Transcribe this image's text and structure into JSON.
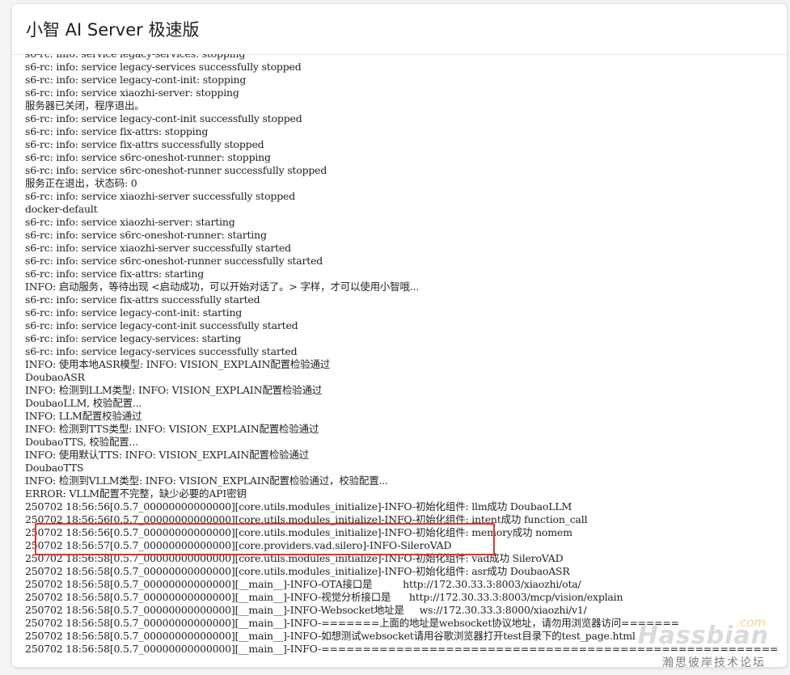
{
  "app": {
    "title": "小智 AI Server 极速版"
  },
  "log": {
    "lines": [
      "s6-rc: info: service legacy-services: stopping",
      "s6-rc: info: service legacy-services successfully stopped",
      "s6-rc: info: service legacy-cont-init: stopping",
      "s6-rc: info: service xiaozhi-server: stopping",
      "服务器已关闭，程序退出。",
      "s6-rc: info: service legacy-cont-init successfully stopped",
      "s6-rc: info: service fix-attrs: stopping",
      "s6-rc: info: service fix-attrs successfully stopped",
      "s6-rc: info: service s6rc-oneshot-runner: stopping",
      "s6-rc: info: service s6rc-oneshot-runner successfully stopped",
      "服务正在退出，状态码: 0",
      "s6-rc: info: service xiaozhi-server successfully stopped",
      "docker-default",
      "s6-rc: info: service xiaozhi-server: starting",
      "s6-rc: info: service s6rc-oneshot-runner: starting",
      "s6-rc: info: service xiaozhi-server successfully started",
      "s6-rc: info: service s6rc-oneshot-runner successfully started",
      "s6-rc: info: service fix-attrs: starting",
      "INFO: 启动服务，等待出现 <启动成功，可以开始对话了。> 字样，才可以使用小智哦...",
      "s6-rc: info: service fix-attrs successfully started",
      "s6-rc: info: service legacy-cont-init: starting",
      "s6-rc: info: service legacy-cont-init successfully started",
      "s6-rc: info: service legacy-services: starting",
      "s6-rc: info: service legacy-services successfully started",
      "INFO: 使用本地ASR模型: INFO: VISION_EXPLAIN配置检验通过",
      "DoubaoASR",
      "INFO: 检测到LLM类型: INFO: VISION_EXPLAIN配置检验通过",
      "DoubaoLLM, 校验配置...",
      "INFO: LLM配置校验通过",
      "INFO: 检测到TTS类型: INFO: VISION_EXPLAIN配置检验通过",
      "DoubaoTTS, 校验配置...",
      "INFO: 使用默认TTS: INFO: VISION_EXPLAIN配置检验通过",
      "DoubaoTTS",
      "INFO: 检测到VLLM类型: INFO: VISION_EXPLAIN配置检验通过，校验配置...",
      "ERROR: VLLM配置不完整，缺少必要的API密钥",
      "250702 18:56:56[0.5.7_00000000000000][core.utils.modules_initialize]-INFO-初始化组件: llm成功 DoubaoLLM",
      "250702 18:56:56[0.5.7_00000000000000][core.utils.modules_initialize]-INFO-初始化组件: intent成功 function_call",
      "250702 18:56:56[0.5.7_00000000000000][core.utils.modules_initialize]-INFO-初始化组件: memory成功 nomem",
      "250702 18:56:57[0.5.7_00000000000000][core.providers.vad.silero]-INFO-SileroVAD",
      "250702 18:56:58[0.5.7_00000000000000][core.utils.modules_initialize]-INFO-初始化组件: vad成功 SileroVAD",
      "250702 18:56:58[0.5.7_00000000000000][core.utils.modules_initialize]-INFO-初始化组件: asr成功 DoubaoASR",
      "250702 18:56:58[0.5.7_00000000000000][__main__]-INFO-OTA接口是          http://172.30.33.3:8003/xiaozhi/ota/",
      "250702 18:56:58[0.5.7_00000000000000][__main__]-INFO-视觉分析接口是      http://172.30.33.3:8003/mcp/vision/explain",
      "250702 18:56:58[0.5.7_00000000000000][__main__]-INFO-Websocket地址是     ws://172.30.33.3:8000/xiaozhi/v1/",
      "250702 18:56:58[0.5.7_00000000000000][__main__]-INFO-=======上面的地址是websocket协议地址，请勿用浏览器访问=======",
      "250702 18:56:58[0.5.7_00000000000000][__main__]-INFO-如想测试websocket请用谷歌浏览器打开test目录下的test_page.html",
      "250702 18:56:58[0.5.7_00000000000000][__main__]-INFO-=============================================================="
    ]
  },
  "watermark": {
    "brand": "Hassbian",
    "domain_suffix": ".com",
    "subtitle": "瀚思彼岸技术论坛"
  },
  "colors": {
    "highlight_border": "#e5322d",
    "log_text": "#222222",
    "background": "#ffffff"
  }
}
